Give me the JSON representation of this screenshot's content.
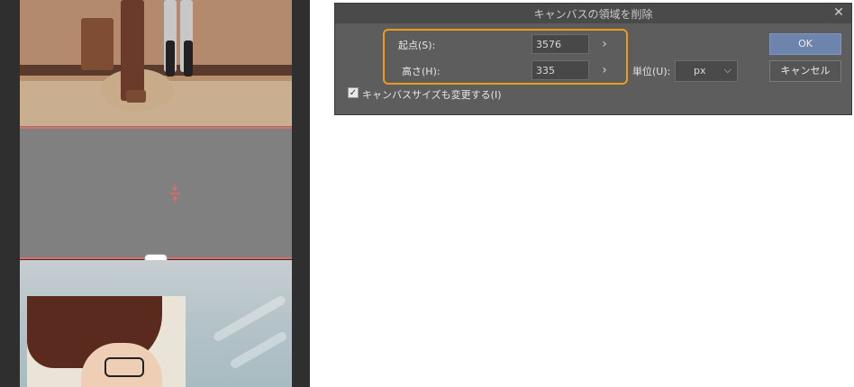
{
  "dialog": {
    "title": "キャンバスの領域を削除",
    "close_icon": "close-icon",
    "start_label": "起点(S):",
    "start_value": "3576",
    "height_label": "高さ(H):",
    "height_value": "335",
    "unit_label": "単位(U):",
    "unit_value": "px",
    "ok_label": "OK",
    "cancel_label": "キャンセル",
    "resize_canvas_label": "キャンバスサイズも変更する(I)",
    "resize_canvas_checked": true,
    "highlight_color": "#ee9b1a",
    "accent_color": "#6d84ad"
  },
  "canvas": {
    "guide_color": "#e46969",
    "removal_zone_color": "#808080"
  }
}
